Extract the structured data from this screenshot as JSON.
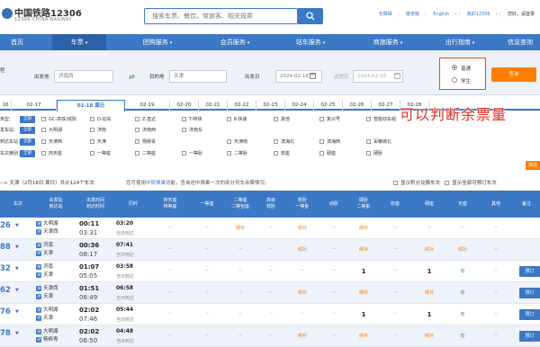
{
  "header": {
    "logo_cn": "中国铁路12306",
    "logo_en": "12306 CHINA RAILWAY",
    "search_placeholder": "搜索车票、餐饮、常旅客、相关规章",
    "links": [
      "无障碍",
      "敬老版",
      "English",
      "我的12306"
    ],
    "greeting": "您好，请登录"
  },
  "nav": [
    {
      "label": "首页",
      "caret": false
    },
    {
      "label": "车票",
      "caret": true
    },
    {
      "label": "团购服务",
      "caret": true
    },
    {
      "label": "会员服务",
      "caret": true
    },
    {
      "label": "站车服务",
      "caret": true
    },
    {
      "label": "商旅服务",
      "caret": true
    },
    {
      "label": "出行指南",
      "caret": true
    },
    {
      "label": "信息查询",
      "caret": false
    }
  ],
  "query": {
    "left_edge_label": "程",
    "from_label": "出发地",
    "from_value": "济南西",
    "to_label": "目的地",
    "to_value": "天津",
    "depart_label": "出发日",
    "depart_value": "2024-02-18",
    "return_label": "返程日",
    "return_value": "2024-02-16",
    "ticket_types": [
      "普通",
      "学生"
    ],
    "selected_type": "普通",
    "query_button": "查询"
  },
  "date_tabs": [
    "16",
    "02-17",
    "02-18 周日",
    "02-19",
    "02-20",
    "02-21",
    "02-22",
    "02-23",
    "02-24",
    "02-25",
    "02-26",
    "02-27",
    "02-28"
  ],
  "active_date": "02-18 周日",
  "overlay_text": "可以判断余票量",
  "filters": {
    "all_label": "全部",
    "rows": [
      {
        "label": "类型：",
        "options": [
          "GC-高铁/城际",
          "D-动车",
          "Z-直达",
          "T-特快",
          "K-快速",
          "其他",
          "复兴号",
          "智能动车组"
        ]
      },
      {
        "label": "发车站：",
        "options": [
          "大明湖",
          "济南",
          "济南西",
          "济南东"
        ]
      },
      {
        "label": "到达车站：",
        "options": [
          "天津西",
          "天津",
          "杨柳青",
          "天津南",
          "滨海北",
          "滨海西",
          "军粮城北"
        ]
      },
      {
        "label": "车次席别：",
        "options": [
          "商务座",
          "一等座",
          "二等座",
          "一等卧",
          "二等卧",
          "软座",
          "硬座",
          "硬卧"
        ]
      }
    ],
    "filter_button": "筛选"
  },
  "summary": {
    "route": "--> 天津（2月18日 周日）共计124个车次",
    "notice_prefix": "您可使用",
    "notice_link": "中转换乘",
    "notice_suffix": "功能，查询途中换乘一次的部分列车余票情况。",
    "option_1": "显示积分兑换车次",
    "option_2": "显示全部可预订车次"
  },
  "table": {
    "headers": [
      "车次",
      "出发站\n到达站",
      "出发时间\n到达时间",
      "历时",
      "商务座\n特等座",
      "一等座",
      "二等座\n二等包座",
      "高级\n软卧",
      "软卧\n一等卧",
      "动卧",
      "硬卧\n二等卧",
      "软座",
      "硬座",
      "无座",
      "其他",
      "备注"
    ],
    "rows": [
      {
        "train": "26",
        "from": "大明湖",
        "to": "天津西",
        "dep": "00:11",
        "arr": "03:31",
        "dur": "03:20",
        "dur_note": "当日到达",
        "seats": [
          "--",
          "--",
          "候补",
          "--",
          "候补",
          "--",
          "候补",
          "--",
          "--",
          "--",
          "--"
        ],
        "book": ""
      },
      {
        "train": "88",
        "from": "济南",
        "to": "天津",
        "dep": "00:36",
        "arr": "08:17",
        "dur": "07:41",
        "dur_note": "当日到达",
        "seats": [
          "--",
          "--",
          "--",
          "--",
          "候补",
          "--",
          "候补",
          "--",
          "候补",
          "候补",
          "--"
        ],
        "book": ""
      },
      {
        "train": "32",
        "from": "济南",
        "to": "天津",
        "dep": "01:07",
        "arr": "05:05",
        "dur": "03:58",
        "dur_note": "当日到达",
        "seats": [
          "--",
          "--",
          "--",
          "--",
          "--",
          "--",
          "1",
          "--",
          "1",
          "有",
          "--"
        ],
        "book": "预订"
      },
      {
        "train": "62",
        "from": "天津西",
        "to": "天津",
        "dep": "01:51",
        "arr": "08:49",
        "dur": "06:58",
        "dur_note": "当日到达",
        "seats": [
          "--",
          "--",
          "--",
          "--",
          "候补",
          "--",
          "候补",
          "--",
          "候补",
          "有",
          "--"
        ],
        "book": "预订"
      },
      {
        "train": "76",
        "from": "大明湖",
        "to": "天津",
        "dep": "02:02",
        "arr": "07:46",
        "dur": "05:44",
        "dur_note": "当日到达",
        "seats": [
          "--",
          "--",
          "--",
          "--",
          "--",
          "--",
          "1",
          "--",
          "1",
          "有",
          "--"
        ],
        "book": "预订"
      },
      {
        "train": "78",
        "from": "大明湖",
        "to": "杨柳青",
        "dep": "02:02",
        "arr": "06:50",
        "dur": "04:48",
        "dur_note": "当日到达",
        "seats": [
          "--",
          "--",
          "--",
          "--",
          "候补",
          "--",
          "候补",
          "--",
          "候补",
          "有",
          "--"
        ],
        "book": "预订"
      }
    ]
  },
  "colors": {
    "brand_blue": "#3b78c6",
    "accent_orange": "#ff7f00",
    "overlay_red": "#e0301e",
    "green": "#3b9b56"
  }
}
